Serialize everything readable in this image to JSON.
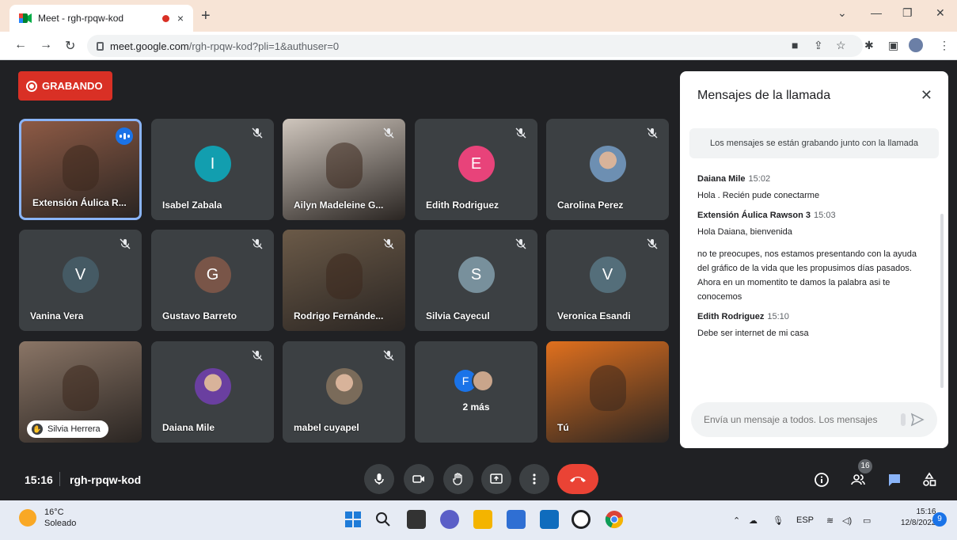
{
  "browser": {
    "tab_title": "Meet - rgh-rpqw-kod",
    "tab_close": "×",
    "new_tab": "+",
    "url_host": "meet.google.com",
    "url_path": "/rgh-rpqw-kod?pli=1&authuser=0"
  },
  "meet": {
    "recording_label": "GRABANDO",
    "participants": [
      {
        "name": "Extensión Áulica R...",
        "type": "video",
        "color": "#8d5a45"
      },
      {
        "name": "Isabel Zabala",
        "type": "letter",
        "letter": "I",
        "color": "#129eaf"
      },
      {
        "name": "Ailyn Madeleine G...",
        "type": "video",
        "color": "#cfc6bd"
      },
      {
        "name": "Edith Rodriguez",
        "type": "letter",
        "letter": "E",
        "color": "#e8437a"
      },
      {
        "name": "Carolina Perez",
        "type": "photo",
        "color": "#6d8fb2"
      },
      {
        "name": "Vanina Vera",
        "type": "letter",
        "letter": "V",
        "color": "#455a64"
      },
      {
        "name": "Gustavo Barreto",
        "type": "letter",
        "letter": "G",
        "color": "#795548"
      },
      {
        "name": "Rodrigo Fernánde...",
        "type": "video",
        "color": "#6b5a48"
      },
      {
        "name": "Silvia Cayecul",
        "type": "letter",
        "letter": "S",
        "color": "#78909c"
      },
      {
        "name": "Veronica Esandi",
        "type": "letter",
        "letter": "V",
        "color": "#546e7a"
      },
      {
        "name": "Silvia Herrera",
        "type": "video",
        "color": "#8a7566"
      },
      {
        "name": "Daiana Mile",
        "type": "photo",
        "color": "#6a3fa0"
      },
      {
        "name": "mabel cuyapel",
        "type": "photo",
        "color": "#7a6b5a"
      },
      {
        "name": "2 más",
        "type": "more",
        "letter": "F",
        "color": "#1a73e8"
      },
      {
        "name": "Tú",
        "type": "video",
        "color": "#e0701e"
      }
    ],
    "time": "15:16",
    "meeting_code": "rgh-rpqw-kod",
    "people_count": "16"
  },
  "chat": {
    "title": "Mensajes de la llamada",
    "close": "✕",
    "banner": "Los mensajes se están grabando junto con la llamada",
    "messages": [
      {
        "author": "Daiana Mile",
        "time": "15:02",
        "texts": [
          "Hola . Recién pude conectarme"
        ]
      },
      {
        "author": "Extensión Áulica Rawson 3",
        "time": "15:03",
        "texts": [
          "Hola Daiana, bienvenida",
          "no te preocupes, nos estamos presentando con la ayuda del gráfico de la vida que les propusimos días pasados. Ahora en un momentito te damos la palabra asi te conocemos"
        ]
      },
      {
        "author": "Edith Rodriguez",
        "time": "15:10",
        "texts": [
          "Debe ser internet de mi casa"
        ]
      }
    ],
    "input_placeholder": "Envía un mensaje a todos. Los mensajes"
  },
  "taskbar": {
    "temp": "16°C",
    "weather": "Soleado",
    "lang": "ESP",
    "clock_time": "15:16",
    "clock_date": "12/8/2022",
    "notifications": "9"
  }
}
